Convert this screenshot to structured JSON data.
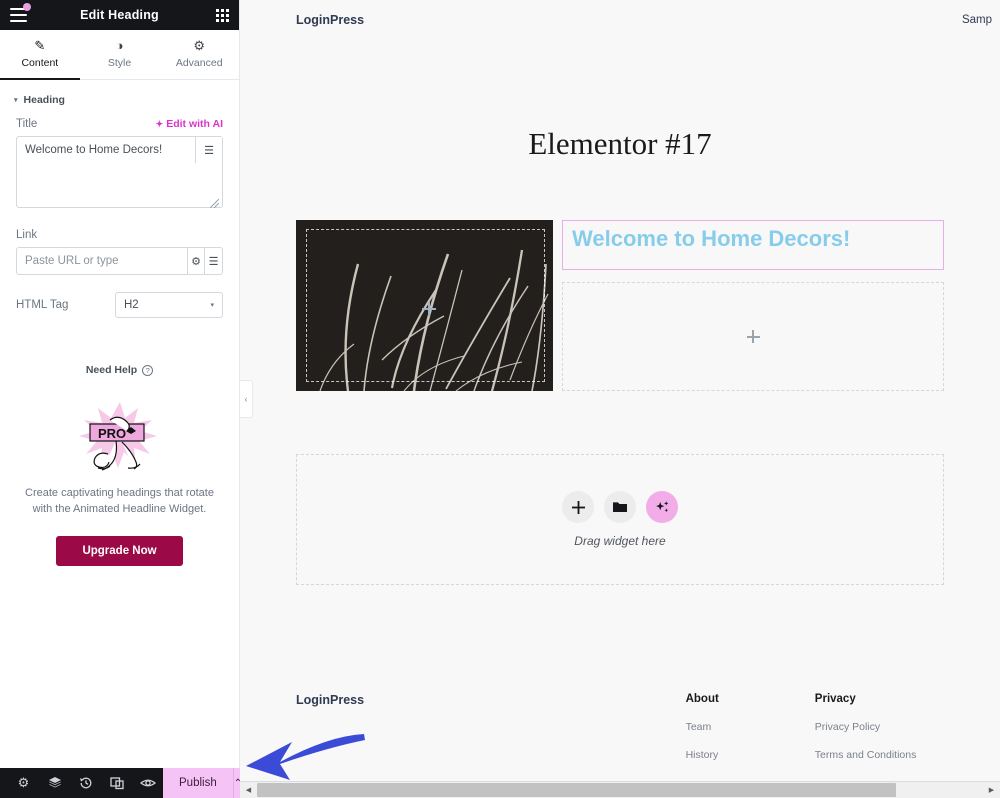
{
  "panel": {
    "header": {
      "title": "Edit Heading",
      "menu_icon": "hamburger-icon",
      "apps_icon": "grid-apps-icon"
    },
    "tabs": [
      {
        "label": "Content",
        "icon": "pencil-icon",
        "active": true
      },
      {
        "label": "Style",
        "icon": "contrast-circle-icon",
        "active": false
      },
      {
        "label": "Advanced",
        "icon": "gear-icon",
        "active": false
      }
    ],
    "section": {
      "label": "Heading",
      "caret": "▾"
    },
    "title_field": {
      "label": "Title",
      "ai_link": "Edit with AI",
      "value": "Welcome to Home Decors!",
      "dynamic_icon": "database-stack-icon"
    },
    "link_field": {
      "label": "Link",
      "placeholder": "Paste URL or type",
      "value": "",
      "settings_icon": "gear-icon",
      "dynamic_icon": "database-stack-icon"
    },
    "html_tag": {
      "label": "HTML Tag",
      "value": "H2",
      "caret": "▾"
    },
    "need_help": {
      "label": "Need Help",
      "icon": "question-circle-icon"
    },
    "promo": {
      "art_label": "PRO",
      "text": "Create captivating headings that rotate with the Animated Headline Widget.",
      "button": "Upgrade Now",
      "button_color": "#9b0a46"
    },
    "footer": {
      "icons": [
        {
          "name": "settings-gear-icon",
          "glyph": "⚙"
        },
        {
          "name": "navigator-layers-icon",
          "glyph": "≡"
        },
        {
          "name": "history-revisions-icon",
          "glyph": "↺"
        },
        {
          "name": "responsive-preview-icon",
          "glyph": "▧"
        },
        {
          "name": "preview-eye-icon",
          "glyph": "◉"
        }
      ],
      "publish_label": "Publish",
      "publish_caret": "⌃",
      "publish_color": "#f5c3f5"
    },
    "collapse_caret": "‹"
  },
  "canvas": {
    "site_header": {
      "brand": "LoginPress",
      "nav_item": "Samp"
    },
    "page_title": "Elementor #17",
    "image_widget": {
      "name": "image-widget",
      "alt": "dark photo of grass blades"
    },
    "heading_widget": {
      "text": "Welcome to Home Decors!",
      "color": "#87cdeb",
      "selection_border": "#e9aeea"
    },
    "empty_column": {
      "add_icon": "plus-icon"
    },
    "drop_zone": {
      "label": "Drag widget here",
      "buttons": [
        {
          "name": "add-widget-button",
          "glyph": "+"
        },
        {
          "name": "folder-templates-button",
          "glyph": "▰"
        },
        {
          "name": "ai-sparkle-button",
          "glyph": "✦",
          "color": "#f2ade8"
        }
      ]
    },
    "footer": {
      "brand": "LoginPress",
      "columns": [
        {
          "heading": "About",
          "links": [
            "Team",
            "History"
          ]
        },
        {
          "heading": "Privacy",
          "links": [
            "Privacy Policy",
            "Terms and Conditions"
          ]
        }
      ]
    }
  },
  "scrollbar": {
    "left_arrow": "◀",
    "right_arrow": "▶"
  },
  "annotation": {
    "arrow_color": "#3b4bd8",
    "points_to": "panel-collapse-handle"
  }
}
